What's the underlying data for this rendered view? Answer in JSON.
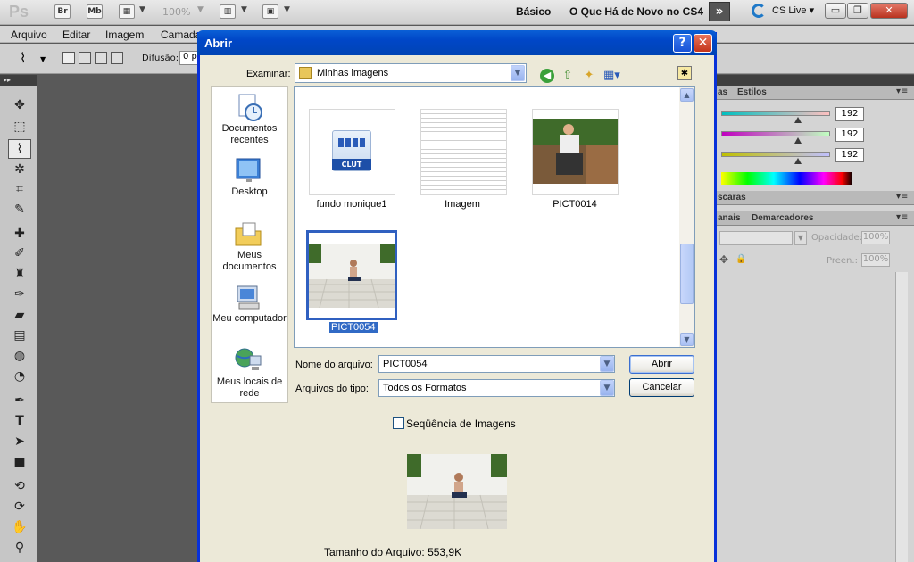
{
  "app": {
    "logo": "Ps",
    "bridge_button": "Br",
    "minibridge_button": "Mb",
    "zoom": "100%",
    "workspace_basic": "Básico",
    "workspace_new": "O Que Há de Novo no CS4",
    "more": "»",
    "cs_live": "CS Live",
    "minimize": "▭",
    "restore": "❐",
    "close": "✕"
  },
  "menubar": [
    "Arquivo",
    "Editar",
    "Imagem",
    "Camada"
  ],
  "options": {
    "feather_label": "Difusão:",
    "feather_value": "0 p"
  },
  "panels": {
    "color_tabs": [
      "as",
      "Estilos"
    ],
    "color_values": [
      192,
      192,
      192
    ],
    "masks_tab": "scaras",
    "layers_tabs": [
      "anais",
      "Demarcadores"
    ],
    "opacity_label": "Opacidade:",
    "opacity_value": "100%",
    "fill_label": "Preen.:",
    "fill_value": "100%"
  },
  "dialog": {
    "title": "Abrir",
    "help": "?",
    "close": "✕",
    "look_in_label": "Examinar:",
    "look_in_value": "Minhas imagens",
    "places": [
      {
        "label": "Documentos recentes"
      },
      {
        "label": "Desktop"
      },
      {
        "label": "Meus documentos"
      },
      {
        "label": "Meu computador"
      },
      {
        "label": "Meus locais de rede"
      }
    ],
    "files": [
      {
        "name": "fundo monique1",
        "badge": "CLUT"
      },
      {
        "name": "Imagem"
      },
      {
        "name": "PICT0014"
      },
      {
        "name": "PICT0054",
        "selected": true
      }
    ],
    "filename_label": "Nome do arquivo:",
    "filename_value": "PICT0054",
    "filetype_label": "Arquivos do tipo:",
    "filetype_value": "Todos os Formatos",
    "open_button": "Abrir",
    "cancel_button": "Cancelar",
    "sequence_label": "Seqüência de Imagens",
    "sequence_checked": false,
    "file_size": "Tamanho do Arquivo: 553,9K"
  }
}
